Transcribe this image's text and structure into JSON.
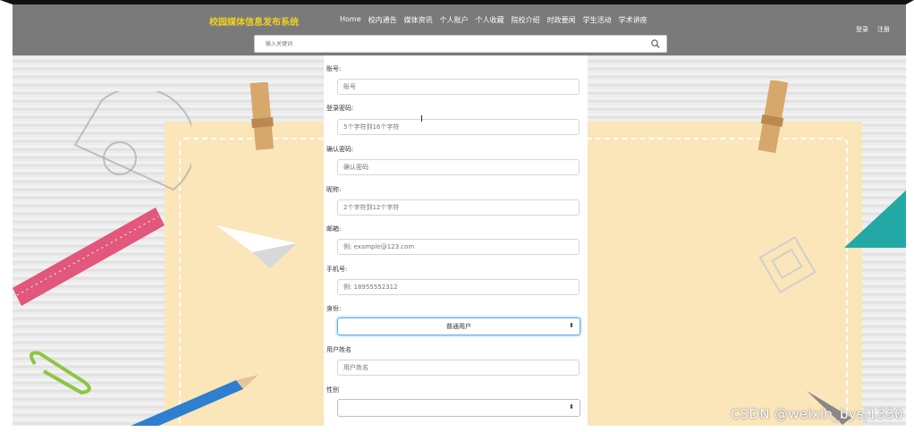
{
  "header": {
    "brand": "校园媒体信息发布系统",
    "nav": [
      "Home",
      "校内通告",
      "媒体资讯",
      "个人账户",
      "个人收藏",
      "院校介绍",
      "时政要闻",
      "学生活动",
      "学术讲座"
    ],
    "login": "登录",
    "register": "注册",
    "search_placeholder": "输入关键词"
  },
  "form": {
    "fields": [
      {
        "label": "账号:",
        "placeholder": "账号"
      },
      {
        "label": "登录密码:",
        "placeholder": "5个字符到16个字符"
      },
      {
        "label": "确认密码:",
        "placeholder": "确认密码"
      },
      {
        "label": "昵称:",
        "placeholder": "2个字符到12个字符"
      },
      {
        "label": "邮箱:",
        "placeholder": "例: example@123.com"
      },
      {
        "label": "手机号:",
        "placeholder": "例: 18955552312"
      }
    ],
    "role_label": "身份:",
    "role_value": "普通用户",
    "realname_label": "用户姓名",
    "realname_placeholder": "用户姓名",
    "gender_label": "性别",
    "gender_value": ""
  },
  "watermark": "CSDN @weixin_bysj1330",
  "colors": {
    "header_bg": "#7a7a7a",
    "brand": "#f0d21d",
    "paper": "#fbe6b9",
    "focus": "#66afe9"
  }
}
